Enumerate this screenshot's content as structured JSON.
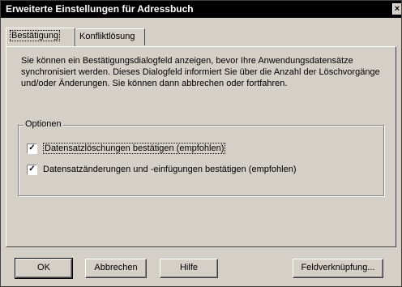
{
  "window": {
    "title": "Erweiterte Einstellungen für Adressbuch",
    "close_glyph": "×"
  },
  "tabs": [
    {
      "label": "Bestätigung",
      "active": true
    },
    {
      "label": "Konfliktlösung",
      "active": false
    }
  ],
  "description": "Sie können ein Bestätigungsdialogfeld anzeigen, bevor Ihre Anwendungsdatensätze synchronisiert werden. Dieses Dialogfeld informiert Sie über die Anzahl der Löschvorgänge und/oder Änderungen. Sie können dann abbrechen oder fortfahren.",
  "options": {
    "legend": "Optionen",
    "checkboxes": [
      {
        "label": "Datensatzlöschungen bestätigen (empfohlen)",
        "checked": true,
        "mark": "✓"
      },
      {
        "label": "Datensatzänderungen und -einfügungen bestätigen (empfohlen)",
        "checked": true,
        "mark": "✓"
      }
    ]
  },
  "buttons": {
    "ok": "OK",
    "cancel": "Abbrechen",
    "help": "Hilfe",
    "field_mapping": "Feldverknüpfung..."
  }
}
